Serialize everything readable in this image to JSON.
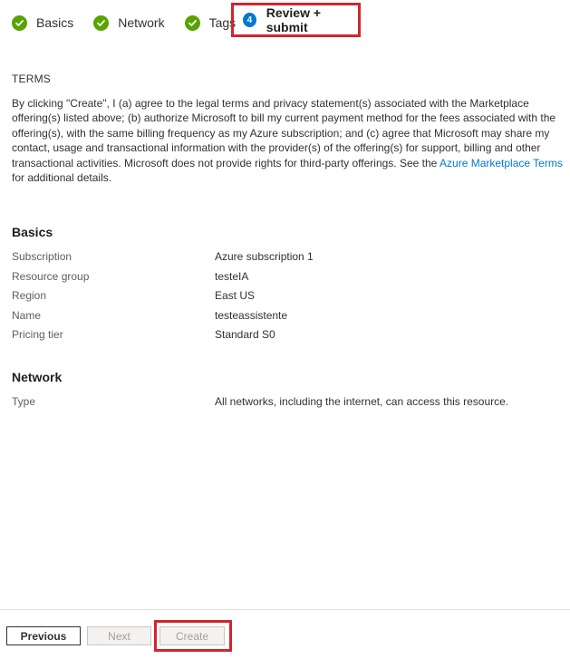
{
  "steps": [
    {
      "label": "Basics",
      "state": "complete",
      "icon": "checkmark-icon"
    },
    {
      "label": "Network",
      "state": "complete",
      "icon": "checkmark-icon"
    },
    {
      "label": "Tags",
      "state": "complete",
      "icon": "checkmark-icon"
    },
    {
      "label": "Review + submit",
      "state": "current",
      "number": "4"
    }
  ],
  "terms": {
    "heading": "TERMS",
    "text_before_link": "By clicking \"Create\", I (a) agree to the legal terms and privacy statement(s) associated with the Marketplace offering(s) listed above; (b) authorize Microsoft to bill my current payment method for the fees associated with the offering(s), with the same billing frequency as my Azure subscription; and (c) agree that Microsoft may share my contact, usage and transactional information with the provider(s) of the offering(s) for support, billing and other transactional activities. Microsoft does not provide rights for third-party offerings. See the ",
    "link_text": "Azure Marketplace Terms",
    "text_after_link": " for additional details."
  },
  "basics": {
    "title": "Basics",
    "rows": [
      {
        "label": "Subscription",
        "value": "Azure subscription 1"
      },
      {
        "label": "Resource group",
        "value": "testeIA"
      },
      {
        "label": "Region",
        "value": "East US"
      },
      {
        "label": "Name",
        "value": "testeassistente"
      },
      {
        "label": "Pricing tier",
        "value": "Standard S0"
      }
    ]
  },
  "network": {
    "title": "Network",
    "rows": [
      {
        "label": "Type",
        "value": "All networks, including the internet, can access this resource."
      }
    ]
  },
  "footer": {
    "previous_label": "Previous",
    "next_label": "Next",
    "create_label": "Create"
  },
  "colors": {
    "accent": "#0078d4",
    "complete": "#57a300",
    "highlight": "#d1252f"
  }
}
